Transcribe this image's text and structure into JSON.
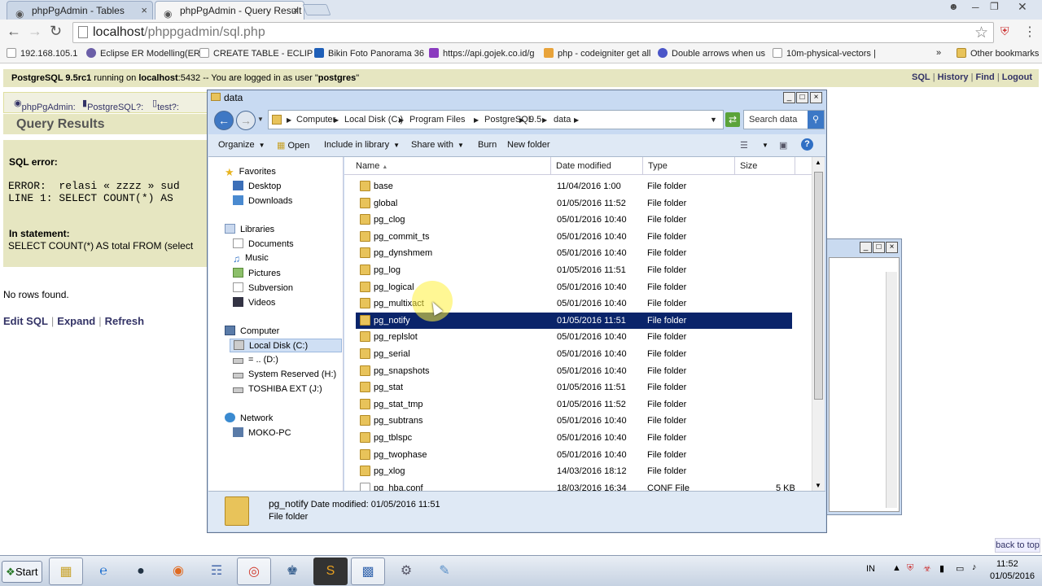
{
  "browser": {
    "tabs": [
      {
        "label": "phpPgAdmin - Tables"
      },
      {
        "label": "phpPgAdmin - Query Result"
      }
    ],
    "url_host": "localhost",
    "url_path": "/phppgadmin/sql.php",
    "bookmarks": [
      {
        "label": "192.168.105.1",
        "color": "#999999"
      },
      {
        "label": "Eclipse ER Modelling(ER",
        "color": "#6b5fa8"
      },
      {
        "label": "CREATE TABLE - ECLIP",
        "color": "#ffffff"
      },
      {
        "label": "Bikin Foto Panorama 36",
        "color": "#1f5fb8"
      },
      {
        "label": "https://api.gojek.co.id/g",
        "color": "#8a3bbf"
      },
      {
        "label": "php - codeigniter get all",
        "color": "#e8a33a"
      },
      {
        "label": "Double arrows when us",
        "color": "#4a55c8"
      },
      {
        "label": "10m-physical-vectors |",
        "color": "#ffffff"
      }
    ],
    "bookmark_more": "»",
    "other_bookmarks": "Other bookmarks"
  },
  "pga": {
    "status_prefix": "PostgreSQL 9.5rc1",
    "status_running": " running on ",
    "status_host": "localhost",
    "status_rest": ":5432 -- You are logged in as user \"",
    "status_user": "postgres",
    "status_end": "\"",
    "links": [
      "SQL",
      "History",
      "Find",
      "Logout"
    ],
    "trail": [
      "phpPgAdmin:",
      "PostgreSQL?:",
      "test?:"
    ],
    "page_title": "Query Results",
    "sql_error_label": "SQL error:",
    "error_line1": "ERROR:  relasi « zzzz » sud",
    "error_line2": "LINE 1: SELECT COUNT(*) AS",
    "in_statement_label": "In statement:",
    "statement": "SELECT COUNT(*) AS total FROM (select",
    "no_rows": "No rows found.",
    "actions": [
      "Edit SQL",
      "Expand",
      "Refresh"
    ],
    "back_to_top": "back to top"
  },
  "explorer": {
    "title": "data",
    "breadcrumbs": [
      "Computer",
      "Local Disk (C:)",
      "Program Files",
      "PostgreSQL",
      "9.5",
      "data"
    ],
    "search_placeholder": "Search data",
    "commands": [
      "Organize",
      "Open",
      "Include in library",
      "Share with",
      "Burn",
      "New folder"
    ],
    "nav": {
      "favorites": "Favorites",
      "fav_items": [
        "Desktop",
        "Downloads"
      ],
      "libraries": "Libraries",
      "lib_items": [
        "Documents",
        "Music",
        "Pictures",
        "Subversion",
        "Videos"
      ],
      "computer": "Computer",
      "comp_items": [
        "Local Disk (C:)",
        "= .. (D:)",
        "System Reserved (H:)",
        "TOSHIBA EXT (J:)"
      ],
      "network": "Network",
      "net_items": [
        "MOKO-PC"
      ]
    },
    "columns": [
      "Name",
      "Date modified",
      "Type",
      "Size"
    ],
    "rows": [
      {
        "name": "base",
        "date": "11/04/2016 1:00",
        "type": "File folder",
        "size": ""
      },
      {
        "name": "global",
        "date": "01/05/2016 11:52",
        "type": "File folder",
        "size": ""
      },
      {
        "name": "pg_clog",
        "date": "05/01/2016 10:40",
        "type": "File folder",
        "size": ""
      },
      {
        "name": "pg_commit_ts",
        "date": "05/01/2016 10:40",
        "type": "File folder",
        "size": ""
      },
      {
        "name": "pg_dynshmem",
        "date": "05/01/2016 10:40",
        "type": "File folder",
        "size": ""
      },
      {
        "name": "pg_log",
        "date": "01/05/2016 11:51",
        "type": "File folder",
        "size": ""
      },
      {
        "name": "pg_logical",
        "date": "05/01/2016 10:40",
        "type": "File folder",
        "size": ""
      },
      {
        "name": "pg_multixact",
        "date": "05/01/2016 10:40",
        "type": "File folder",
        "size": ""
      },
      {
        "name": "pg_notify",
        "date": "01/05/2016 11:51",
        "type": "File folder",
        "size": ""
      },
      {
        "name": "pg_replslot",
        "date": "05/01/2016 10:40",
        "type": "File folder",
        "size": ""
      },
      {
        "name": "pg_serial",
        "date": "05/01/2016 10:40",
        "type": "File folder",
        "size": ""
      },
      {
        "name": "pg_snapshots",
        "date": "05/01/2016 10:40",
        "type": "File folder",
        "size": ""
      },
      {
        "name": "pg_stat",
        "date": "01/05/2016 11:51",
        "type": "File folder",
        "size": ""
      },
      {
        "name": "pg_stat_tmp",
        "date": "01/05/2016 11:52",
        "type": "File folder",
        "size": ""
      },
      {
        "name": "pg_subtrans",
        "date": "05/01/2016 10:40",
        "type": "File folder",
        "size": ""
      },
      {
        "name": "pg_tblspc",
        "date": "05/01/2016 10:40",
        "type": "File folder",
        "size": ""
      },
      {
        "name": "pg_twophase",
        "date": "05/01/2016 10:40",
        "type": "File folder",
        "size": ""
      },
      {
        "name": "pg_xlog",
        "date": "14/03/2016 18:12",
        "type": "File folder",
        "size": ""
      },
      {
        "name": "pg_hba.conf",
        "date": "18/03/2016 16:34",
        "type": "CONF File",
        "size": "5 KB"
      }
    ],
    "selected_index": 8,
    "details_name": "pg_notify",
    "details_modified_label": "Date modified:",
    "details_modified": "01/05/2016 11:51",
    "details_type": "File folder"
  },
  "taskbar": {
    "start": "Start",
    "lang": "IN",
    "time": "11:52",
    "date": "01/05/2016"
  }
}
